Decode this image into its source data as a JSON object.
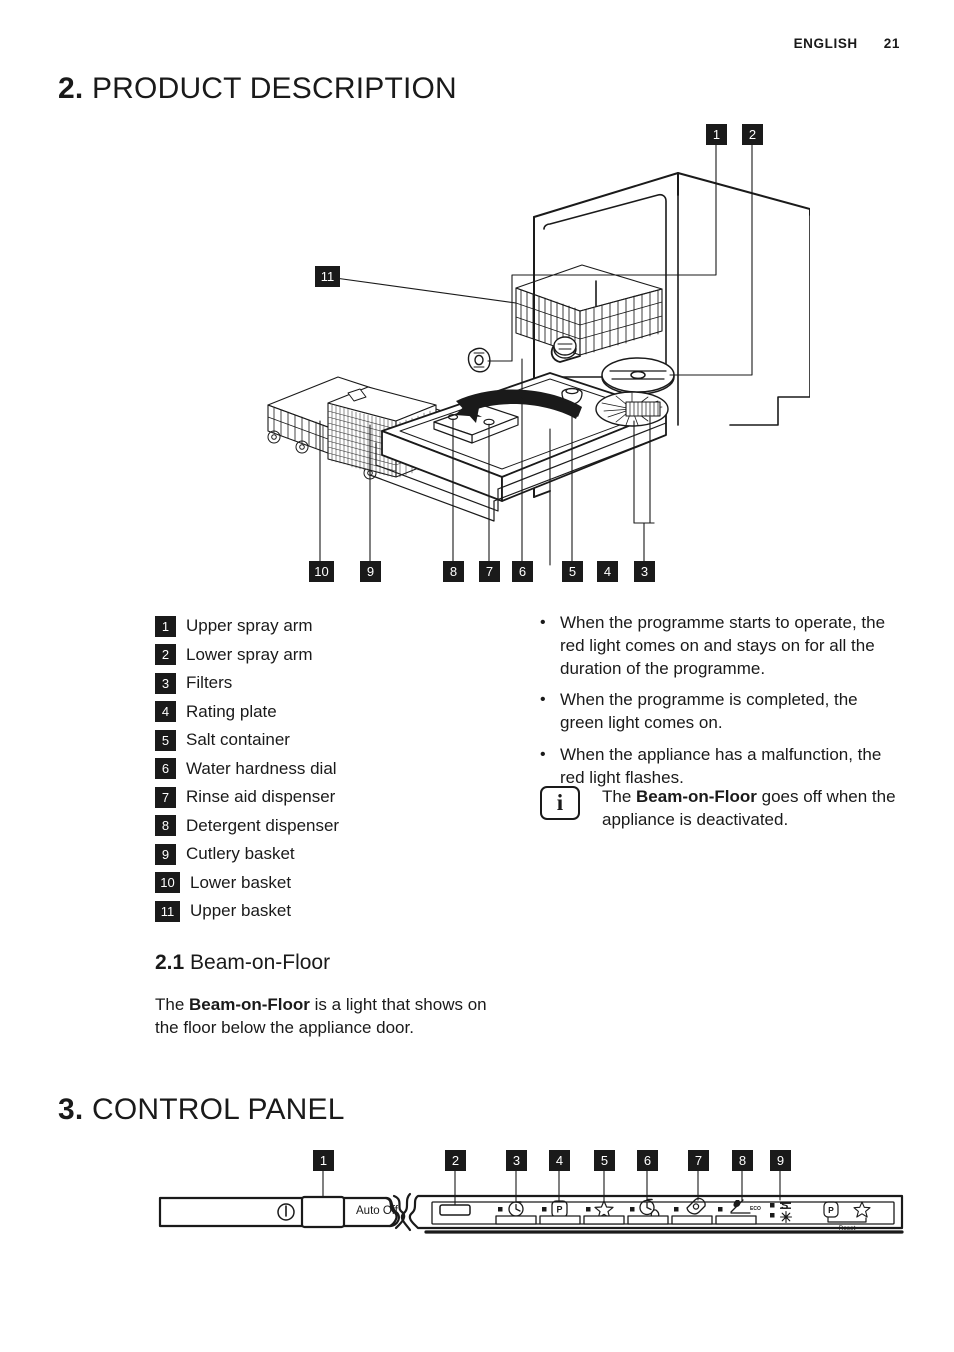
{
  "header": {
    "language": "ENGLISH",
    "page_number": "21"
  },
  "sections": {
    "product": {
      "number": "2.",
      "title": "PRODUCT DESCRIPTION"
    },
    "beam": {
      "number": "2.1",
      "title": "Beam-on-Floor"
    },
    "control": {
      "number": "3.",
      "title": "CONTROL PANEL"
    }
  },
  "parts": [
    {
      "n": "1",
      "label": "Upper spray arm"
    },
    {
      "n": "2",
      "label": "Lower spray arm"
    },
    {
      "n": "3",
      "label": "Filters"
    },
    {
      "n": "4",
      "label": "Rating plate"
    },
    {
      "n": "5",
      "label": "Salt container"
    },
    {
      "n": "6",
      "label": "Water hardness dial"
    },
    {
      "n": "7",
      "label": "Rinse aid dispenser"
    },
    {
      "n": "8",
      "label": "Detergent dispenser"
    },
    {
      "n": "9",
      "label": "Cutlery basket"
    },
    {
      "n": "10",
      "label": "Lower basket"
    },
    {
      "n": "11",
      "label": "Upper basket"
    }
  ],
  "figure_callouts": {
    "top": [
      "1",
      "2"
    ],
    "left": [
      "11"
    ],
    "bottom": [
      "10",
      "9",
      "8",
      "7",
      "6",
      "5",
      "4",
      "3"
    ]
  },
  "notes": [
    "When the programme starts to operate, the red light comes on and stays on for all the duration of the programme.",
    "When the programme is completed, the green light comes on.",
    "When the appliance has a malfunction, the red light flashes."
  ],
  "info_note": {
    "icon": "info-icon",
    "prefix": "The ",
    "bold": "Beam-on-Floor",
    "suffix": " goes off when the appliance is deactivated."
  },
  "beam_body": {
    "prefix": "The ",
    "bold": "Beam-on-Floor",
    "suffix": " is a light that shows on the floor below the appliance door."
  },
  "control_panel": {
    "callouts": [
      "1",
      "2",
      "3",
      "4",
      "5",
      "6",
      "7",
      "8",
      "9"
    ],
    "on_off_icon": "power-icon",
    "auto_off_label": "Auto Off",
    "reset_label": "Reset",
    "buttons": [
      {
        "name": "on-off-button",
        "icon": "power-icon"
      },
      {
        "name": "programme-button",
        "icon": "blank-pad-icon"
      },
      {
        "name": "delay-start-button",
        "icon": "clock-icon"
      },
      {
        "name": "programme-p-button",
        "icon": "p-tag-icon"
      },
      {
        "name": "extra-option-button",
        "icon": "star-icon"
      },
      {
        "name": "time-save-button",
        "icon": "clock-check-icon"
      },
      {
        "name": "multitab-button",
        "icon": "tablet-icon"
      },
      {
        "name": "eco-button",
        "icon": "eco-icon"
      }
    ],
    "indicators": [
      {
        "name": "salt-indicator",
        "icon": "salt-icon"
      },
      {
        "name": "rinse-aid-indicator",
        "icon": "sunburst-icon"
      }
    ],
    "reset_combo": [
      {
        "name": "p-tag-icon",
        "icon": "p-tag-icon"
      },
      {
        "name": "star-icon",
        "icon": "star-icon"
      }
    ],
    "eco_sublabel": "ECO"
  },
  "colors": {
    "ink": "#1a1a1a",
    "paper": "#ffffff"
  }
}
